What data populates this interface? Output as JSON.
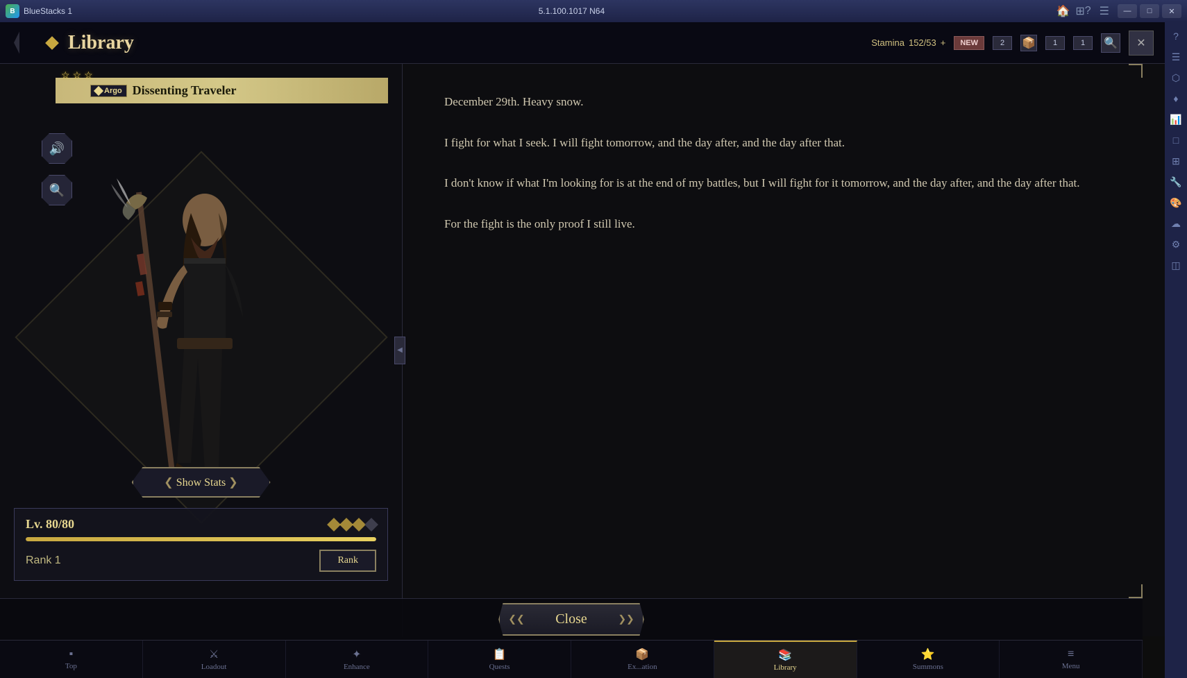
{
  "titleBar": {
    "appName": "BlueStacks 1",
    "version": "5.1.100.1017 N64",
    "homeIcon": "🏠",
    "multiIcon": "⊞",
    "minimizeLabel": "—",
    "maximizeLabel": "□",
    "closeLabel": "✕",
    "questionIcon": "?",
    "menuIcon": "☰"
  },
  "topBar": {
    "backLabel": "◀",
    "title": "Library",
    "staminaLabel": "Stamina",
    "staminaValue": "152/53",
    "badge1": "NEW",
    "badge2": "2",
    "badge3": "1",
    "badge4": "1",
    "searchIcon": "🔍",
    "closeIcon": "✕"
  },
  "character": {
    "stars": [
      "☆",
      "☆",
      "☆"
    ],
    "typeBadge": "Argo",
    "name": "Dissenting Traveler",
    "soundIcon": "🔊",
    "searchIcon": "🔍",
    "showStatsLabel": "Show Stats",
    "levelLabel": "Lv. 80/80",
    "diamonds": [
      true,
      true,
      true,
      false
    ],
    "rankLabel": "Rank 1",
    "rankBtnLabel": "Rank"
  },
  "story": {
    "paragraphs": [
      "December 29th. Heavy snow.",
      "I fight for what I seek. I will fight tomorrow, and the day after, and the day after that.",
      "I don't know if what I'm looking for is at the end of my battles, but I will fight for it tomorrow, and the day after, and the day after that.",
      "For the fight is the only proof I still live."
    ]
  },
  "closeBtn": {
    "label": "Close"
  },
  "bottomNav": {
    "items": [
      {
        "icon": "▪",
        "label": "Top",
        "active": false
      },
      {
        "icon": "⚔",
        "label": "Loadout",
        "active": false
      },
      {
        "icon": "✦",
        "label": "Enhance",
        "active": false
      },
      {
        "icon": "📋",
        "label": "Quests",
        "active": false
      },
      {
        "icon": "📦",
        "label": "Ex...ation",
        "active": false
      },
      {
        "icon": "📚",
        "label": "Library",
        "active": true
      },
      {
        "icon": "⭐",
        "label": "Summons",
        "active": false
      },
      {
        "icon": "≡",
        "label": "Menu",
        "active": false
      }
    ]
  },
  "sidebarIcons": [
    "?",
    "☰",
    "⬡",
    "♦",
    "📊",
    "□",
    "⊞",
    "🔧",
    "🎨",
    "☁",
    "⚙",
    "◫"
  ]
}
